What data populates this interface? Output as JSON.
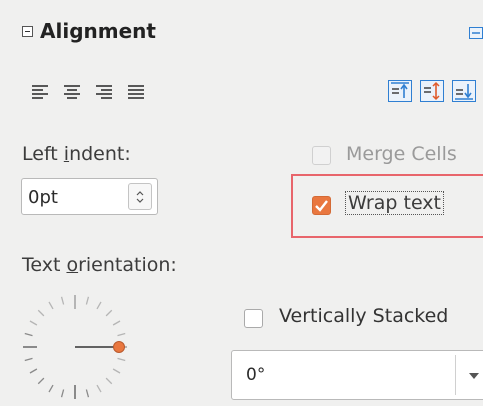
{
  "section": {
    "title": "Alignment"
  },
  "left_indent": {
    "label_pre": "Left ",
    "label_mnemonic": "i",
    "label_post": "ndent:",
    "value": "0pt"
  },
  "merge_cells": {
    "label": "Merge Cells",
    "checked": false,
    "enabled": false
  },
  "wrap_text": {
    "label": "Wrap text",
    "checked": true
  },
  "text_orientation": {
    "label_pre": "Text ",
    "label_mnemonic": "o",
    "label_post": "rientation:"
  },
  "vertically_stacked": {
    "label": "Vertically Stacked",
    "checked": false
  },
  "rotation": {
    "value": "0°"
  },
  "colors": {
    "accent": "#e9773f",
    "highlight_border": "#e8656b",
    "blue_icon": "#2f7fd2"
  }
}
